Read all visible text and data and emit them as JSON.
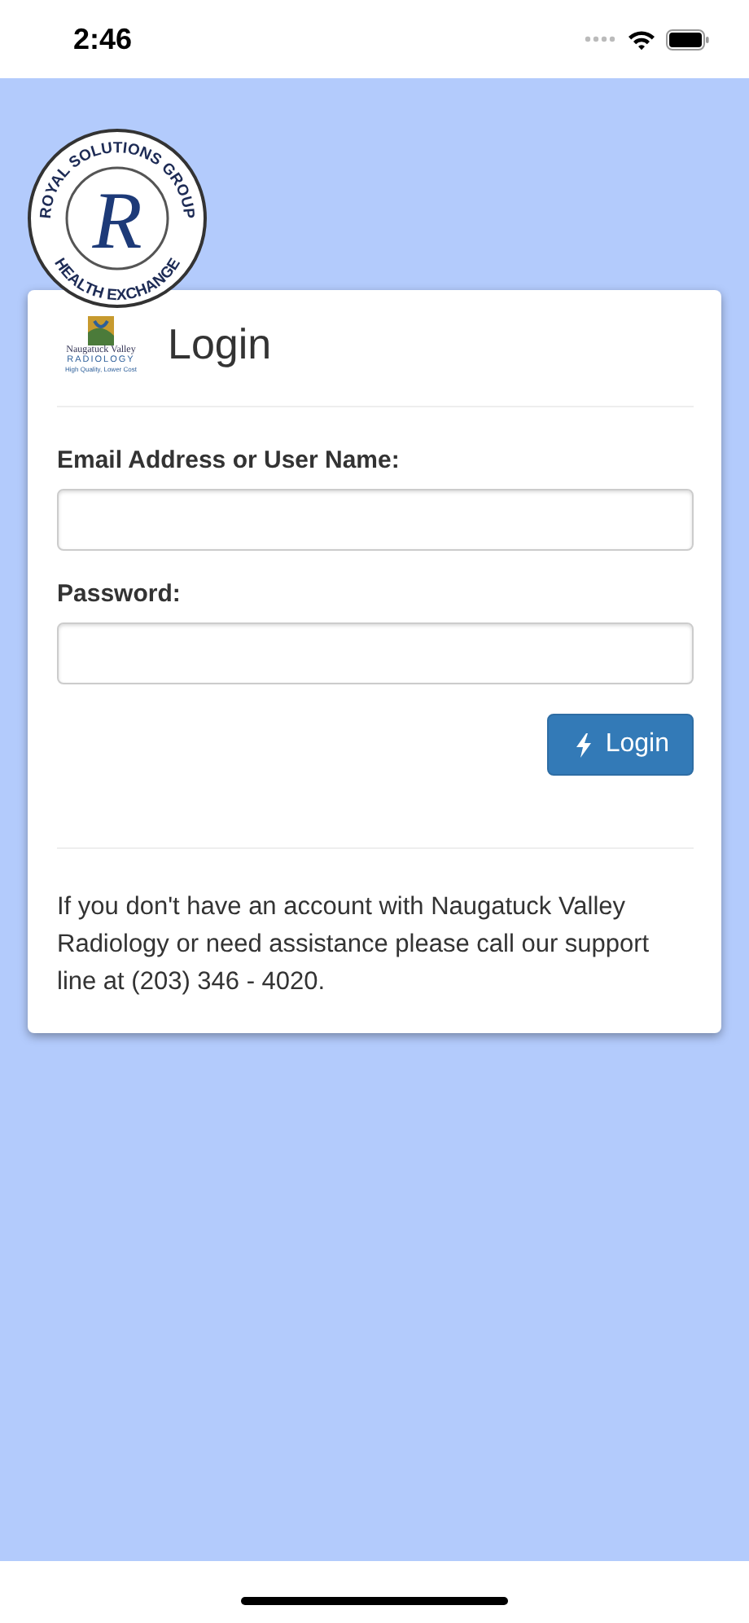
{
  "status_bar": {
    "time": "2:46"
  },
  "header_logo": {
    "top_text": "ROYAL SOLUTIONS GROUP",
    "bottom_text": "HEALTH EXCHANGE",
    "letter": "R"
  },
  "card": {
    "logo": {
      "name_line": "Naugatuck Valley",
      "sub_line": "RADIOLOGY",
      "tagline": "High Quality, Lower Cost"
    },
    "title": "Login",
    "fields": [
      {
        "label": "Email Address or User Name:"
      },
      {
        "label": "Password:"
      }
    ],
    "submit": {
      "label": "Login"
    },
    "note": "If you don't have an account with Naugatuck Valley Radiology or need assistance please call our support line at (203) 346 - 4020."
  }
}
